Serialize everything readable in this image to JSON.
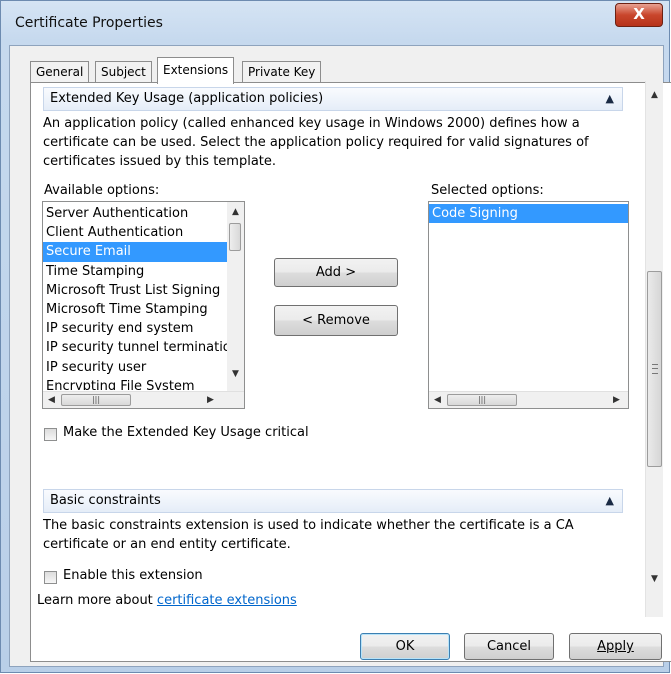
{
  "window": {
    "title": "Certificate Properties",
    "close_glyph": "X"
  },
  "tabs": [
    {
      "label": "General"
    },
    {
      "label": "Subject"
    },
    {
      "label": "Extensions"
    },
    {
      "label": "Private Key"
    }
  ],
  "eku": {
    "header": "Extended Key Usage (application policies)",
    "description": "An application policy (called enhanced key usage in Windows 2000) defines how a certificate can be used. Select the application policy required for valid signatures of certificates issued by this template.",
    "available_label": "Available options:",
    "selected_label": "Selected options:",
    "available_options": [
      "Server Authentication",
      "Client Authentication",
      "Secure Email",
      "Time Stamping",
      "Microsoft Trust List Signing",
      "Microsoft Time Stamping",
      "IP security end system",
      "IP security tunnel termination",
      "IP security user",
      "Encrypting File System"
    ],
    "available_selected_index": 2,
    "selected_options": [
      "Code Signing"
    ],
    "add_label": "Add >",
    "remove_label": "< Remove",
    "critical_label": "Make the Extended Key Usage critical",
    "critical_checked": false
  },
  "basic": {
    "header": "Basic constraints",
    "description": "The basic constraints extension is used to indicate whether the certificate is a CA certificate or an end entity certificate.",
    "enable_label": "Enable this extension",
    "enable_checked": false
  },
  "footer": {
    "learn_prefix": "Learn more about ",
    "learn_link": "certificate extensions"
  },
  "buttons": {
    "ok": "OK",
    "cancel": "Cancel",
    "apply": "Apply"
  },
  "icons": {
    "collapse": "chevron-up-icon",
    "scroll_up": "arrow-up-icon",
    "scroll_down": "arrow-down-icon"
  },
  "colors": {
    "selection": "#3399ff",
    "link": "#0066cc",
    "close_button": "#c9462c"
  }
}
